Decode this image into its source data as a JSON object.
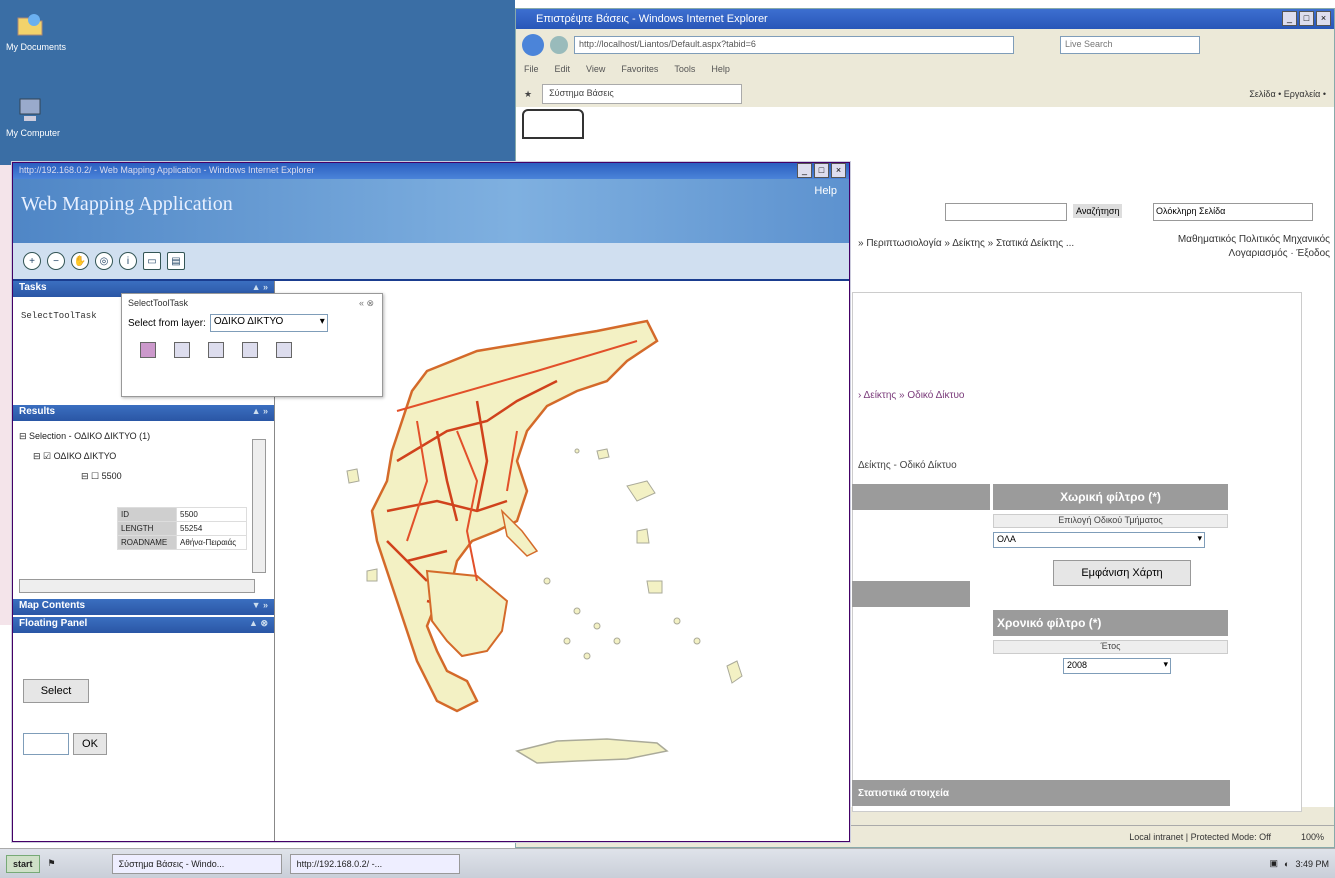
{
  "desktop": {
    "icons": [
      {
        "label": "My Documents",
        "icon": "folder-icon"
      },
      {
        "label": "My Computer",
        "icon": "computer-icon"
      }
    ]
  },
  "ie_back": {
    "title": "Επιστρέψτε Βάσεις - Windows Internet Explorer",
    "address": "http://localhost/Liantos/Default.aspx?tabid=6",
    "search_placeholder": "Live Search",
    "menu": [
      "File",
      "Edit",
      "View",
      "Favorites",
      "Tools",
      "Help"
    ],
    "tab_label": "Σύστημα Βάσεις",
    "tab_tools": "Σελίδα • Εργαλεία •",
    "status_zone": "Local intranet | Protected Mode: Off",
    "status_zoom": "100%"
  },
  "site": {
    "search_button": "Αναζήτηση",
    "search_scope": "Ολόκληρη Σελίδα",
    "nav_links": "» Περιπτωσιολογία » Δείκτης » Στατικά Δείκτης ...",
    "user_line1": "Μαθηματικός Πολιτικός Μηχανικός",
    "user_line2": "Λογαριασμός · Έξοδος",
    "breadcrumb": "› Δείκτης » Οδικό Δίκτυο",
    "subtitle": "Δείκτης - Οδικό Δίκτυο",
    "spatial_filter_title": "Χωρική φίλτρο (*)",
    "spatial_filter_sub": "Επιλογή Οδικού Τμήματος",
    "spatial_filter_value": "ΟΛΑ",
    "show_map_button": "Εμφάνιση Χάρτη",
    "time_filter_title": "Χρονικό φίλτρο (*)",
    "time_filter_sub": "Έτος",
    "time_filter_value": "2008",
    "bottom_bar": "Στατιστικά στοιχεία"
  },
  "wm": {
    "window_title": "http://192.168.0.2/ - Web Mapping Application - Windows Internet Explorer",
    "app_title": "Web Mapping Application",
    "help_link": "Help",
    "tools": [
      "zoom-in-icon",
      "zoom-out-icon",
      "pan-icon",
      "full-extent-icon",
      "identify-icon",
      "measure-icon",
      "print-icon"
    ],
    "tasks": {
      "title": "Tasks",
      "item": "SelectToolTask"
    },
    "select_panel": {
      "title": "SelectToolTask",
      "label": "Select from layer:",
      "value": "ΟΔΙΚΟ ΔΙΚΤΥΟ"
    },
    "results": {
      "title": "Results",
      "line1": "Selection - ΟΔΙΚΟ ΔΙΚΤΥΟ (1)",
      "line2": "ΟΔΙΚΟ ΔΙΚΤΥΟ",
      "line3": "5500",
      "attrs": [
        {
          "k": "ID",
          "v": "5500"
        },
        {
          "k": "LENGTH",
          "v": "55254"
        },
        {
          "k": "ROADNAME",
          "v": "Αθήνα-Πειραιάς"
        }
      ]
    },
    "map_contents": {
      "title": "Map Contents"
    },
    "floating": {
      "title": "Floating Panel",
      "select_button": "Select",
      "ok_button": "OK"
    }
  },
  "taskbar": {
    "start": "start",
    "tasks": [
      "Σύστημα Βάσεις - Windo...",
      "http://192.168.0.2/ -..."
    ],
    "clock": "3:49 PM"
  }
}
